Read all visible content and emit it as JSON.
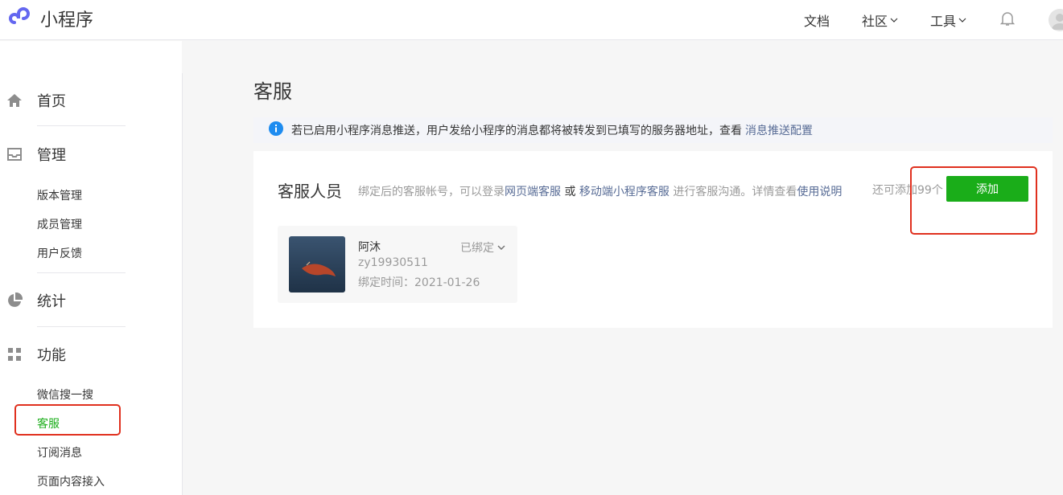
{
  "header": {
    "app_name": "小程序",
    "nav": [
      {
        "label": "文档",
        "has_dropdown": false
      },
      {
        "label": "社区",
        "has_dropdown": true
      },
      {
        "label": "工具",
        "has_dropdown": true
      }
    ],
    "icons": [
      "logo-icon",
      "bell-icon",
      "user-avatar"
    ]
  },
  "sidebar": {
    "sections": [
      {
        "label": "首页",
        "icon": "home-icon",
        "items": []
      },
      {
        "label": "管理",
        "icon": "inbox-icon",
        "items": [
          "版本管理",
          "成员管理",
          "用户反馈"
        ]
      },
      {
        "label": "统计",
        "icon": "pie-chart-icon",
        "items": []
      },
      {
        "label": "功能",
        "icon": "grid-icon",
        "items": [
          "微信搜一搜",
          "客服",
          "订阅消息",
          "页面内容接入"
        ]
      }
    ],
    "active_item": "客服"
  },
  "main": {
    "title": "客服",
    "notice": {
      "text": "若已启用小程序消息推送，用户发给小程序的消息都将被转发到已填写的服务器地址，查看",
      "link": "消息推送配置"
    },
    "card": {
      "title": "客服人员",
      "desc_prefix": "绑定后的客服帐号，可以登录",
      "desc_link1": "网页端客服",
      "desc_or": "或",
      "desc_link2": "移动端小程序客服",
      "desc_mid": "进行客服沟通。详情查看",
      "desc_link3": "使用说明",
      "remaining": "还可添加99个",
      "add_button": "添加",
      "members": [
        {
          "name": "阿沐",
          "account": "zy19930511",
          "bind_time": "绑定时间：2021-01-26",
          "status": "已绑定"
        }
      ]
    }
  },
  "colors": {
    "accent_green": "#1aad19",
    "link_blue": "#576b95",
    "highlight_red": "#e0301e",
    "info_blue": "#1e8cf0"
  }
}
